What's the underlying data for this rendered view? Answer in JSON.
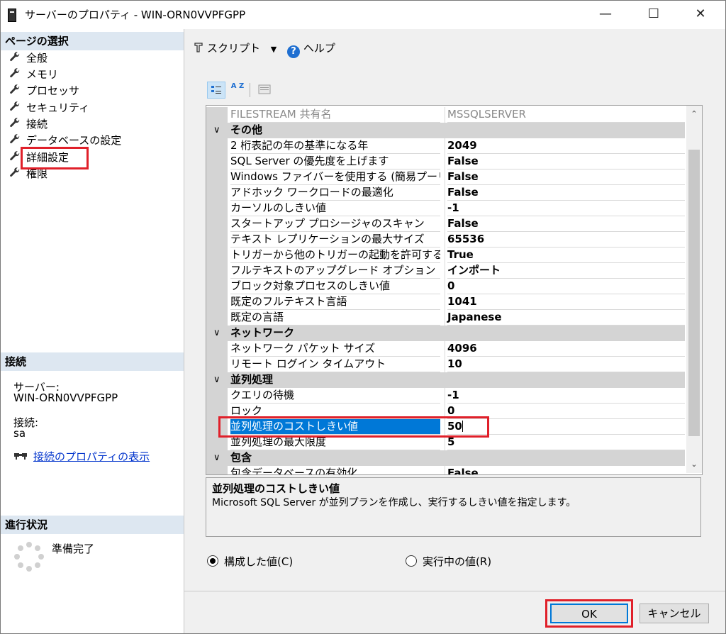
{
  "window": {
    "title": "サーバーのプロパティ - WIN-ORN0VVPFGPP",
    "minimize": "—",
    "maximize": "☐",
    "close": "✕"
  },
  "left": {
    "page_select_header": "ページの選択",
    "pages": [
      "全般",
      "メモリ",
      "プロセッサ",
      "セキュリティ",
      "接続",
      "データベースの設定",
      "詳細設定",
      "権限"
    ],
    "connection_header": "接続",
    "server_label": "サーバー:",
    "server_value": "WIN-ORN0VVPFGPP",
    "conn_label": "接続:",
    "conn_value": "sa",
    "conn_props_link": "接続のプロパティの表示",
    "progress_header": "進行状況",
    "progress_status": "準備完了"
  },
  "toolbar": {
    "script_label": "スクリプト",
    "help_label": "ヘルプ",
    "sort_az": "A Z"
  },
  "grid": {
    "top_row": {
      "name": "FILESTREAM 共有名",
      "value": "MSSQLSERVER"
    },
    "cat_misc": "その他",
    "misc_rows": [
      {
        "name": "2 桁表記の年の基準になる年",
        "value": "2049"
      },
      {
        "name": "SQL Server の優先度を上げます",
        "value": "False"
      },
      {
        "name": "Windows ファイバーを使用する (簡易プーリング)",
        "value": "False"
      },
      {
        "name": "アドホック ワークロードの最適化",
        "value": "False"
      },
      {
        "name": "カーソルのしきい値",
        "value": "-1"
      },
      {
        "name": "スタートアップ プロシージャのスキャン",
        "value": "False"
      },
      {
        "name": "テキスト レプリケーションの最大サイズ",
        "value": "65536"
      },
      {
        "name": "トリガーから他のトリガーの起動を許可する",
        "value": "True"
      },
      {
        "name": "フルテキストのアップグレード オプション",
        "value": "インポート"
      },
      {
        "name": "ブロック対象プロセスのしきい値",
        "value": "0"
      },
      {
        "name": "既定のフルテキスト言語",
        "value": "1041"
      },
      {
        "name": "既定の言語",
        "value": "Japanese"
      }
    ],
    "cat_network": "ネットワーク",
    "network_rows": [
      {
        "name": "ネットワーク パケット サイズ",
        "value": "4096"
      },
      {
        "name": "リモート ログイン タイムアウト",
        "value": "10"
      }
    ],
    "cat_parallel": "並列処理",
    "parallel_rows": [
      {
        "name": "クエリの待機",
        "value": "-1"
      },
      {
        "name": "ロック",
        "value": "0"
      },
      {
        "name": "並列処理のコストしきい値",
        "value": "50"
      },
      {
        "name": "並列処理の最大限度",
        "value": "5"
      }
    ],
    "cat_contain": "包含",
    "contain_rows": [
      {
        "name": "包含データベースの有効化",
        "value": "False"
      }
    ]
  },
  "description": {
    "title": "並列処理のコストしきい値",
    "text": "Microsoft SQL Server が並列プランを作成し、実行するしきい値を指定します。"
  },
  "options": {
    "configured": "構成した値(C)",
    "running": "実行中の値(R)"
  },
  "buttons": {
    "ok": "OK",
    "cancel": "キャンセル"
  }
}
